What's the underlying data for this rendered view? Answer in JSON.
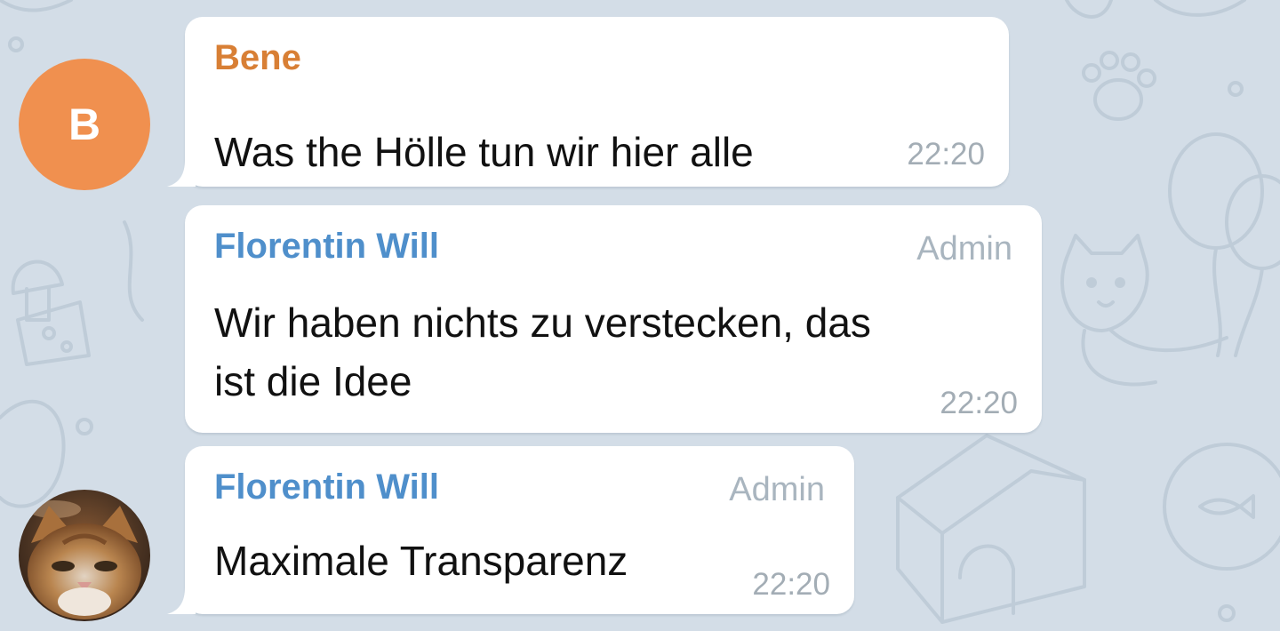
{
  "colors": {
    "wallpaper": "#d3dde7",
    "bubble": "#ffffff",
    "name_orange": "#d87f35",
    "name_blue": "#4f8fcb",
    "avatar_orange": "#f0904f",
    "time_gray": "#a3adb5"
  },
  "messages": [
    {
      "sender": "Bene",
      "avatar_letter": "B",
      "text_lines": [
        "Was the Hölle tun wir hier alle"
      ],
      "time": "22:20"
    },
    {
      "sender": "Florentin Will",
      "role": "Admin",
      "text_lines": [
        "Wir haben nichts zu verstecken, das",
        "ist die Idee"
      ],
      "time": "22:20"
    },
    {
      "sender": "Florentin Will",
      "role": "Admin",
      "avatar_icon": "cat-photo-avatar",
      "text_lines": [
        "Maximale Transparenz"
      ],
      "time": "22:20"
    }
  ]
}
